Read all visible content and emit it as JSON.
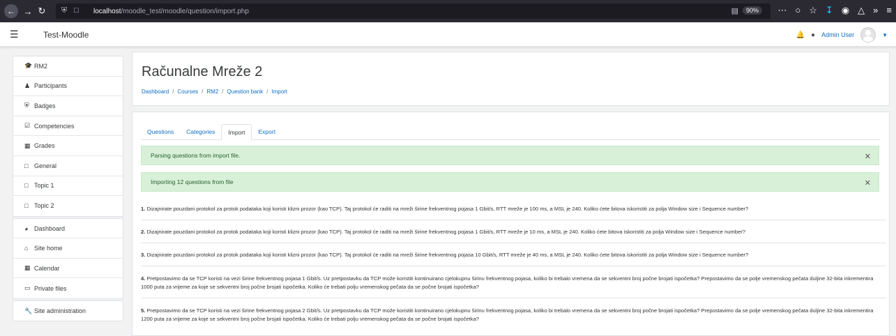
{
  "browser": {
    "url_host": "localhost",
    "url_path": "/moodle_test/moodle/question/import.php",
    "zoom": "90%"
  },
  "navbar": {
    "brand": "Test-Moodle",
    "user_name": "Admin User"
  },
  "sidebar": {
    "groups": [
      [
        {
          "label": "RM2",
          "icon": "graduation-cap-icon"
        },
        {
          "label": "Participants",
          "icon": "users-icon"
        },
        {
          "label": "Badges",
          "icon": "shield-icon"
        },
        {
          "label": "Competencies",
          "icon": "check-square-icon"
        },
        {
          "label": "Grades",
          "icon": "table-icon"
        },
        {
          "label": "General",
          "icon": "folder-icon"
        },
        {
          "label": "Topic 1",
          "icon": "folder-icon"
        },
        {
          "label": "Topic 2",
          "icon": "folder-icon"
        }
      ],
      [
        {
          "label": "Dashboard",
          "icon": "tachometer-icon"
        },
        {
          "label": "Site home",
          "icon": "home-icon"
        },
        {
          "label": "Calendar",
          "icon": "calendar-icon"
        },
        {
          "label": "Private files",
          "icon": "file-icon"
        }
      ],
      [
        {
          "label": "Site administration",
          "icon": "wrench-icon"
        }
      ]
    ]
  },
  "header": {
    "title": "Računalne Mreže 2",
    "breadcrumb": [
      "Dashboard",
      "Courses",
      "RM2",
      "Question bank",
      "Import"
    ]
  },
  "tabs": [
    {
      "label": "Questions",
      "active": false
    },
    {
      "label": "Categories",
      "active": false
    },
    {
      "label": "Import",
      "active": true
    },
    {
      "label": "Export",
      "active": false
    }
  ],
  "alerts": [
    "Parsing questions from import file.",
    "Importing 12 questions from file"
  ],
  "questions": [
    {
      "num": "1.",
      "text": "Dizajnirate pouzdani protokol za protok podataka koji koristi klizni prozor (kao TCP). Taj protokol će raditi na mreži širine frekventnog pojasa 1 Gbit/s, RTT mreže je 100 ms, a MSL je 240. Koliko ćete bitova iskoristiti za polja Window size i Sequence number?"
    },
    {
      "num": "2.",
      "text": "Dizajnirate pouzdani protokol za protok podataka koji koristi klizni prozor (kao TCP). Taj protokol će raditi na mreži širine frekventnog pojasa 1 Gbit/s, RTT mreže je 10 ms, a MSL je 240. Koliko ćete bitova iskoristiti za polja Window size i Sequence number?"
    },
    {
      "num": "3.",
      "text": "Dizajnirate pouzdani protokol za protok podataka koji koristi klizni prozor (kao TCP). Taj protokol će raditi na mreži širine frekventnog pojasa 10 Gbit/s, RTT mreže je 40 ms, a MSL je 240. Koliko ćete bitova iskoristiti za polja Window size i Sequence number?"
    },
    {
      "num": "4.",
      "text": "Pretpostavimo da se TCP koristi na vezi širine frekventnog pojasa 1 Gbit/s. Uz pretpostavku da TCP može koristiti kontinuirano cjelokupnu širinu frekventnog pojasa, koliko bi trebalo vremena da se sekventni broj počne brojati ispočetka? Prepostavimo da se polje vremenskog pečata duljine 32-bita inkrementira 1000 puta za vrijeme za koje se sekventni broj počne brojati ispočetka. Koliko će trebati polju vremenskog pečata da se počne brojati ispočetka?"
    },
    {
      "num": "5.",
      "text": "Pretpostavimo da se TCP koristi na vezi širine frekventnog pojasa 2 Gbit/s. Uz pretpostavku da TCP može koristiti kontinuirano cjelokupnu širinu frekventnog pojasa, koliko bi trebalo vremena da se sekventni broj počne brojati ispočetka? Prepostavimo da se polje vremenskog pečata duljine 32-bita inkrementira 1200 puta za vrijeme za koje se sekventni broj počne brojati ispočetka. Koliko će trebati polju vremenskog pečata da se počne brojati ispočetka?"
    }
  ]
}
